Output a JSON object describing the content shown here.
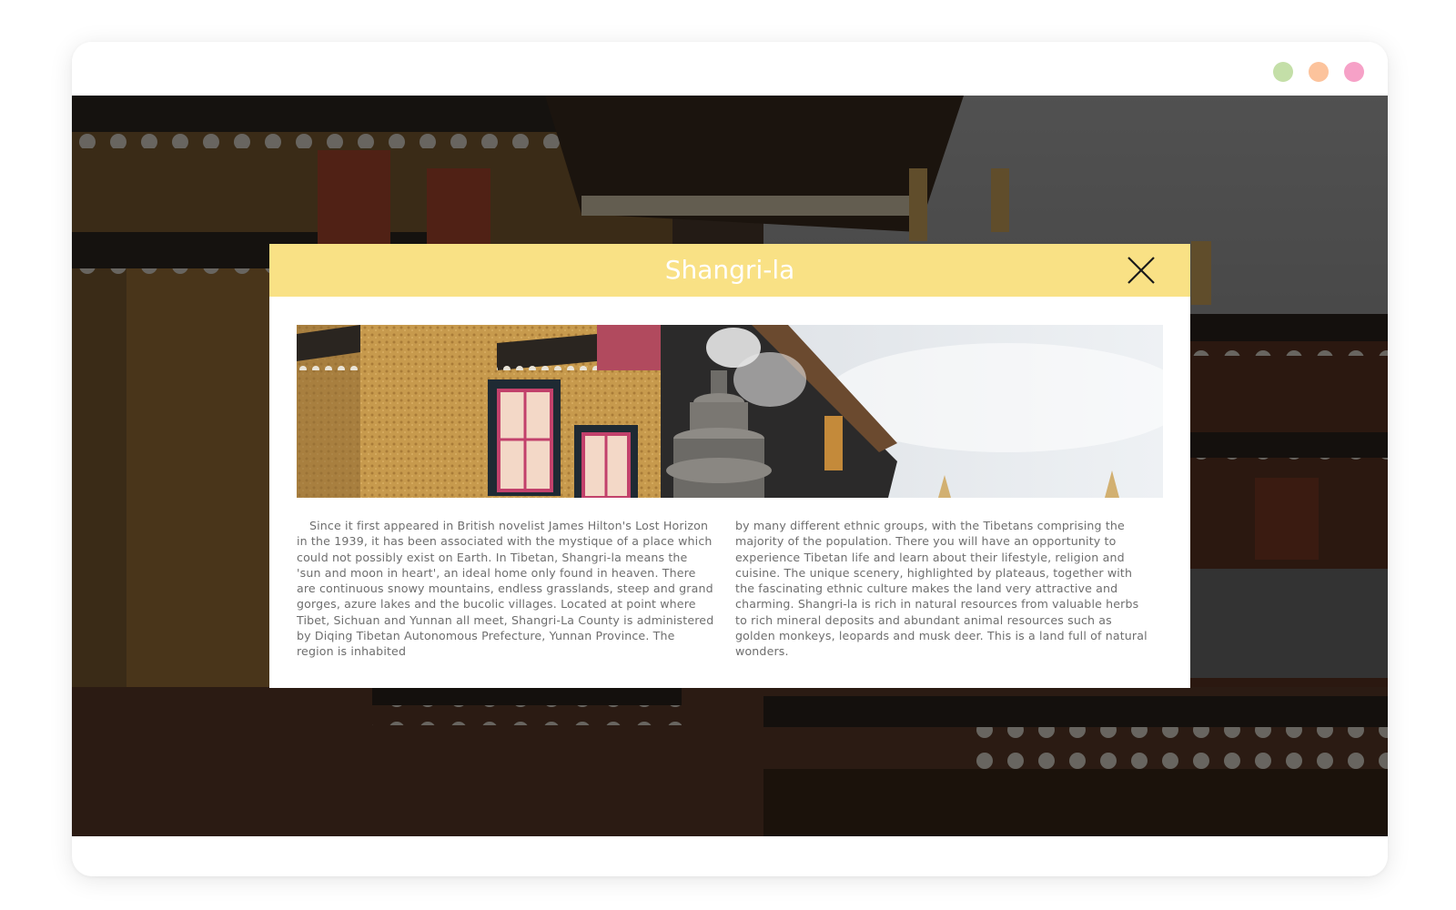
{
  "window": {
    "controls": [
      {
        "name": "green-dot",
        "color": "#c4dfa8"
      },
      {
        "name": "orange-dot",
        "color": "#fcc39c"
      },
      {
        "name": "pink-dot",
        "color": "#f6a1c7"
      }
    ]
  },
  "modal": {
    "title": "Shangri-la",
    "header_color": "#f9e185",
    "close_icon": "close-icon",
    "banner_image": "tibetan-monastery-photo",
    "body_left": "Since it first appeared in British novelist James Hilton's Lost Horizon in the 1939, it has been associated with the mystique of a place which could not possibly exist on Earth. In Tibetan, Shangri-la means the 'sun and moon in heart', an ideal home only found in heaven. There are continuous snowy mountains, endless grasslands, steep and grand gorges, azure lakes and the bucolic villages. Located at point where Tibet, Sichuan and Yunnan all meet, Shangri-La County is administered by Diqing Tibetan Autonomous Prefecture, Yunnan Province. The region is inhabited",
    "body_right": "by many different ethnic groups, with the Tibetans comprising the majority of the population. There you will have an opportunity to experience Tibetan life and learn about their lifestyle, religion and cuisine. The unique scenery, highlighted by plateaus, together with the fascinating ethnic culture makes the land very attractive and charming. Shangri-la is rich in natural resources from valuable herbs to rich mineral deposits and abundant animal resources such as golden monkeys, leopards and musk deer. This is a land full of natural wonders."
  },
  "background": {
    "image": "monastery-background-photo",
    "overlay_color": "rgba(0,0,0,0.52)"
  }
}
